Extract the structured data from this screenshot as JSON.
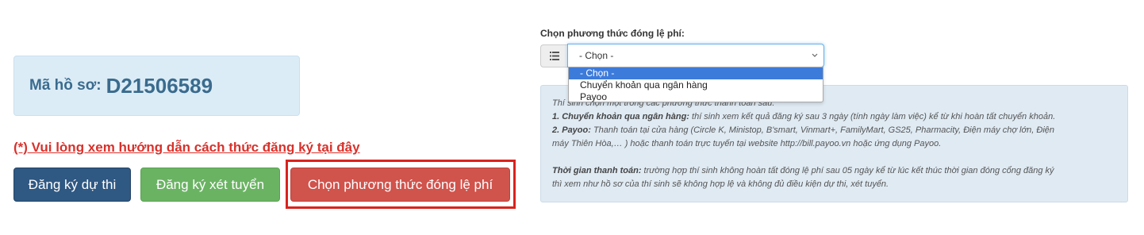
{
  "record": {
    "label": "Mã hồ sơ:",
    "id": "D21506589"
  },
  "guide_link": "(*) Vui lòng xem hướng dẫn cách thức đăng ký tại đây",
  "buttons": {
    "register_exam": "Đăng ký dự thi",
    "register_admission": "Đăng ký xét tuyển",
    "choose_payment": "Chọn phương thức đóng lệ phí"
  },
  "payment": {
    "label": "Chọn phương thức đóng lệ phí:",
    "selected": "- Chọn -",
    "options": [
      "- Chọn -",
      "Chuyển khoản qua ngân hàng",
      "Payoo"
    ]
  },
  "info": {
    "intro": "Thí sinh chọn một trong các phương thức thanh toán sau:",
    "bank_title": "1. Chuyển khoản qua ngân hàng:",
    "bank_text": " thí sinh xem kết quả đăng ký sau 3 ngày (tính ngày làm việc) kể từ khi hoàn tất chuyển khoản.",
    "payoo_title": "2. Payoo:",
    "payoo_text_1": " Thanh toán tại cửa hàng (Circle K, Ministop, B'smart, Vinmart+, FamilyMart, GS25, Pharmacity, Điện máy chợ lớn, Điện",
    "payoo_text_2": "máy Thiên Hòa,… ) hoặc thanh toán trực tuyến tại website http://bill.payoo.vn hoặc ứng dụng Payoo.",
    "time_title": "Thời gian thanh toán:",
    "time_text_1": " trường hợp thí sinh không hoàn tất đóng lệ phí sau 05 ngày kể từ lúc kết thúc thời gian đóng cổng đăng ký",
    "time_text_2": "thì xem như hồ sơ của thí sinh sẽ không hợp lệ và không đủ điều kiện dự thi, xét tuyển."
  },
  "colors": {
    "primary": "#2f5883",
    "success": "#6ab363",
    "danger": "#d0534c",
    "highlight": "#d9231d",
    "info_bg": "#dfeaf3"
  },
  "icons": {
    "select_addon": "list-icon",
    "select_arrow": "chevron-down-icon"
  }
}
